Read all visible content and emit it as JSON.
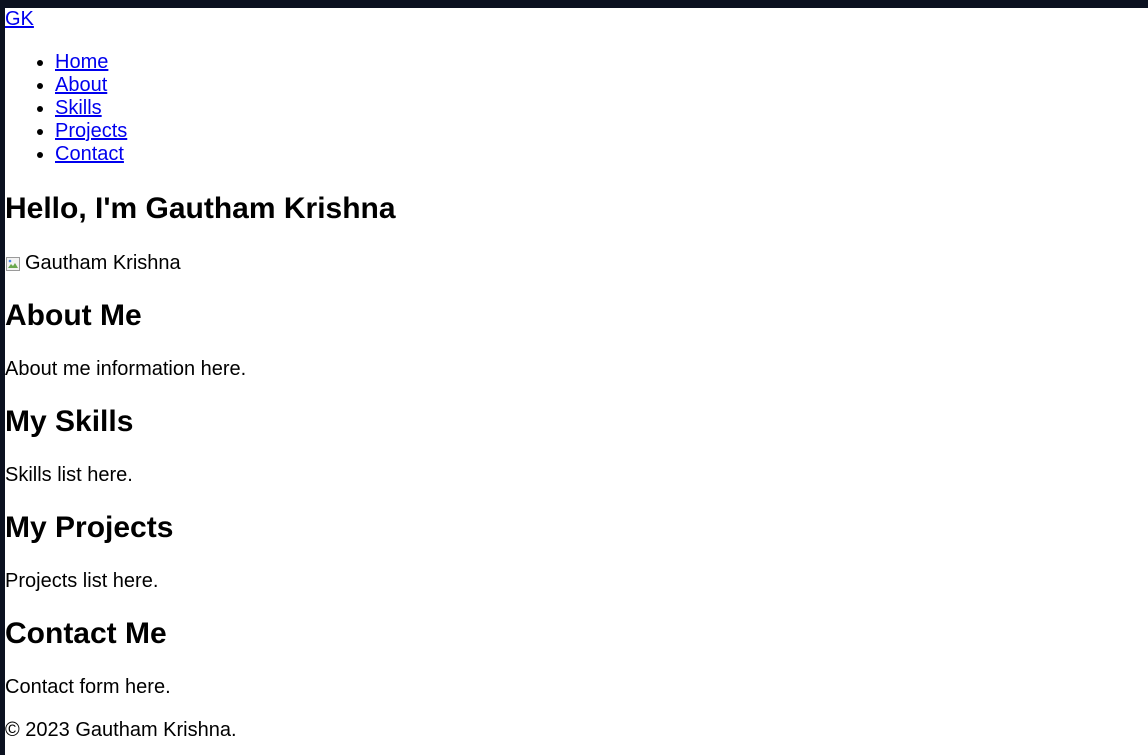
{
  "header": {
    "brand": "GK",
    "nav": [
      "Home",
      "About",
      "Skills",
      "Projects",
      "Contact"
    ]
  },
  "hero": {
    "title": "Hello, I'm Gautham Krishna",
    "image_alt": "Gautham Krishna"
  },
  "sections": {
    "about": {
      "heading": "About Me",
      "text": "About me information here."
    },
    "skills": {
      "heading": "My Skills",
      "text": "Skills list here."
    },
    "projects": {
      "heading": "My Projects",
      "text": "Projects list here."
    },
    "contact": {
      "heading": "Contact Me",
      "text": "Contact form here."
    }
  },
  "footer": {
    "copyright": "© 2023 Gautham Krishna."
  },
  "colors": {
    "link": "#0000ee",
    "frame": "#0b1120",
    "text": "#000000"
  }
}
